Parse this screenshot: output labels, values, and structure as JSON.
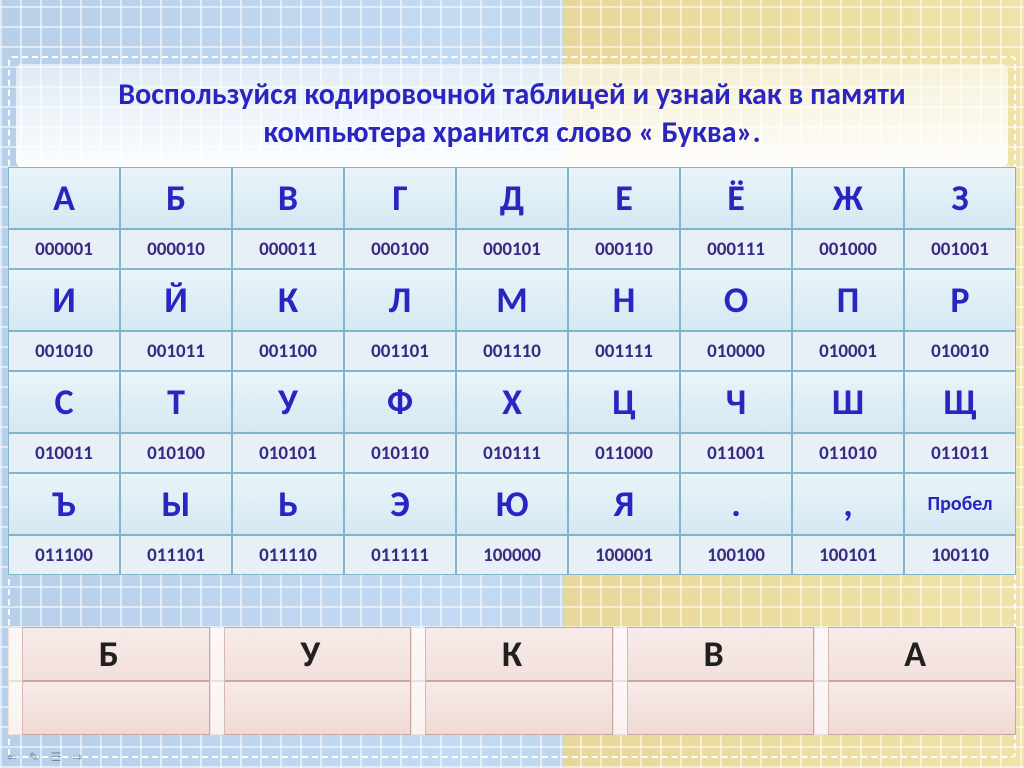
{
  "title": "Воспользуйся кодировочной таблицей  и узнай как в памяти компьютера хранится слово « Буква».",
  "encoding_rows": [
    {
      "letters": [
        "А",
        "Б",
        "В",
        "Г",
        "Д",
        "Е",
        "Ё",
        "Ж",
        "З"
      ],
      "codes": [
        "000001",
        "000010",
        "000011",
        "000100",
        "000101",
        "000110",
        "000111",
        "001000",
        "001001"
      ]
    },
    {
      "letters": [
        "И",
        "Й",
        "К",
        "Л",
        "М",
        "Н",
        "О",
        "П",
        "Р"
      ],
      "codes": [
        "001010",
        "001011",
        "001100",
        "001101",
        "001110",
        "001111",
        "010000",
        "010001",
        "010010"
      ]
    },
    {
      "letters": [
        "С",
        "Т",
        "У",
        "Ф",
        "Х",
        "Ц",
        "Ч",
        "Ш",
        "Щ"
      ],
      "codes": [
        "010011",
        "010100",
        "010101",
        "010110",
        "010111",
        "011000",
        "011001",
        "011010",
        "011011"
      ]
    },
    {
      "letters": [
        "Ъ",
        "Ы",
        "Ь",
        "Э",
        "Ю",
        "Я",
        ".",
        ",",
        "Пробел"
      ],
      "codes": [
        "011100",
        "011101",
        "011110",
        "011111",
        "100000",
        "100001",
        "100100",
        "100101",
        "100110"
      ]
    }
  ],
  "word_letters": [
    "Б",
    "У",
    "К",
    "В",
    "А"
  ],
  "word_answers": [
    "",
    "",
    "",
    "",
    ""
  ],
  "toolbar": {
    "prev": "⇦",
    "pen": "✎",
    "menu": "☰",
    "next": "⇨"
  }
}
